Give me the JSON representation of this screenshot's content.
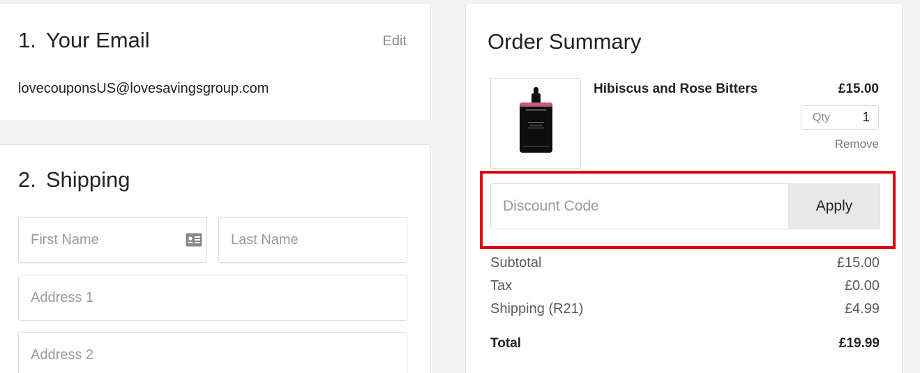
{
  "email_section": {
    "number": "1.",
    "title": "Your Email",
    "edit_label": "Edit",
    "email": "lovecouponsUS@lovesavingsgroup.com"
  },
  "shipping_section": {
    "number": "2.",
    "title": "Shipping",
    "fields": {
      "first_name_placeholder": "First Name",
      "last_name_placeholder": "Last Name",
      "address1_placeholder": "Address 1",
      "address2_placeholder": "Address 2"
    },
    "contact_card_icon": "contact-card-icon"
  },
  "order_summary": {
    "title": "Order Summary",
    "item": {
      "name": "Hibiscus and Rose Bitters",
      "price": "£15.00",
      "qty_label": "Qty",
      "qty_value": "1",
      "remove_label": "Remove",
      "image_icon": "bottle-product-image"
    },
    "discount": {
      "placeholder": "Discount Code",
      "apply_label": "Apply"
    },
    "totals": {
      "subtotal_label": "Subtotal",
      "subtotal_value": "£15.00",
      "tax_label": "Tax",
      "tax_value": "£0.00",
      "shipping_label": "Shipping (R21)",
      "shipping_value": "£4.99",
      "total_label": "Total",
      "total_value": "£19.99"
    }
  },
  "colors": {
    "highlight": "#e0000b",
    "apply_bg": "#e8e8e8",
    "page_bg": "#f4f4f4"
  }
}
